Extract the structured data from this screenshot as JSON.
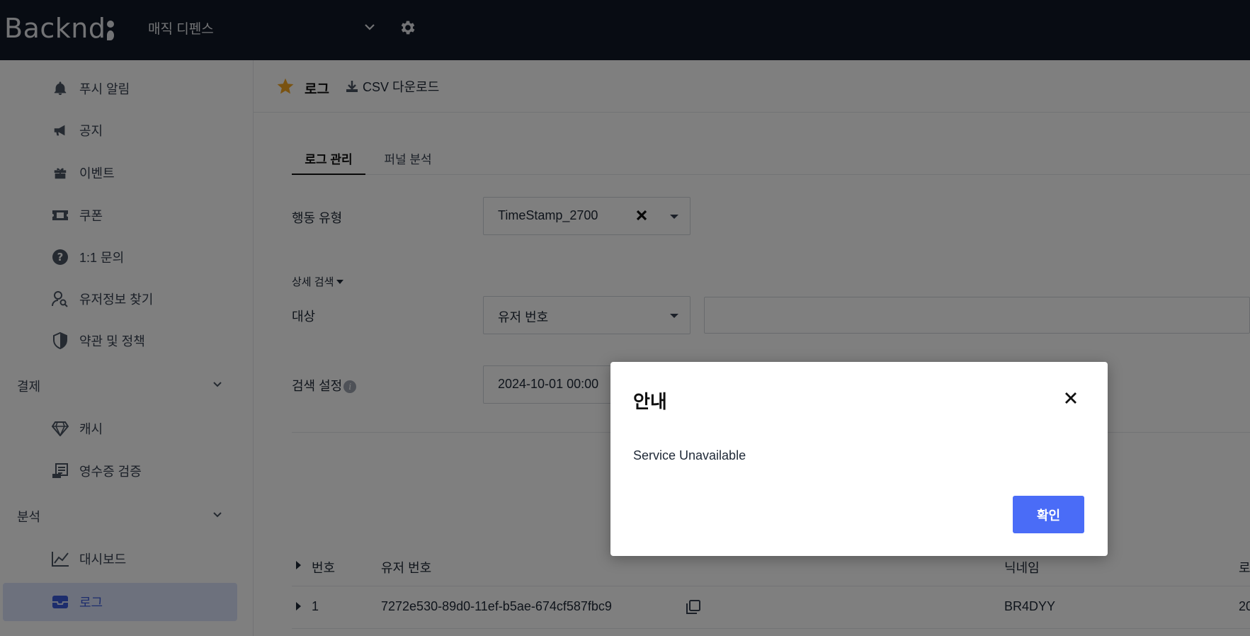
{
  "app": {
    "logo_text": "Backnd",
    "project_name": "매직 디펜스"
  },
  "sidebar": {
    "items": [
      {
        "label": "푸시 알림",
        "icon": "bell-icon"
      },
      {
        "label": "공지",
        "icon": "megaphone-icon"
      },
      {
        "label": "이벤트",
        "icon": "gift-icon"
      },
      {
        "label": "쿠폰",
        "icon": "ticket-icon"
      },
      {
        "label": "1:1 문의",
        "icon": "question-circle-icon"
      },
      {
        "label": "유저정보 찾기",
        "icon": "user-search-icon"
      },
      {
        "label": "약관 및 정책",
        "icon": "shield-icon"
      }
    ],
    "group_payment": {
      "label": "결제"
    },
    "payment_items": [
      {
        "label": "캐시",
        "icon": "diamond-icon"
      },
      {
        "label": "영수증 검증",
        "icon": "receipt-icon"
      }
    ],
    "group_analytics": {
      "label": "분석"
    },
    "analytics_items": [
      {
        "label": "대시보드",
        "icon": "line-chart-icon"
      },
      {
        "label": "로그",
        "icon": "inbox-icon",
        "active": true
      }
    ]
  },
  "header": {
    "title": "로그",
    "csv_label": "CSV 다운로드"
  },
  "tabs": [
    {
      "label": "로그 관리",
      "active": true
    },
    {
      "label": "퍼널 분석"
    }
  ],
  "filters": {
    "action_type_label": "행동 유형",
    "action_type_value": "TimeStamp_2700",
    "advanced_label": "상세 검색",
    "target_label": "대상",
    "target_value": "유저 번호",
    "search_setting_label": "검색 설정",
    "date_value": "2024-10-01 00:00"
  },
  "table": {
    "headers": {
      "num": "번호",
      "user_id": "유저 번호",
      "nickname": "닉네임",
      "last": "로"
    },
    "rows": [
      {
        "num": "1",
        "user_id": "7272e530-89d0-11ef-b5ae-674cf587fbc9",
        "nickname": "BR4DYY",
        "last": "20"
      }
    ]
  },
  "modal": {
    "title": "안내",
    "message": "Service Unavailable",
    "ok_label": "확인"
  },
  "colors": {
    "topbar": "#111827",
    "accent": "#4a6cf7",
    "active_bg": "#dbe3fb",
    "star": "#f5a623"
  }
}
